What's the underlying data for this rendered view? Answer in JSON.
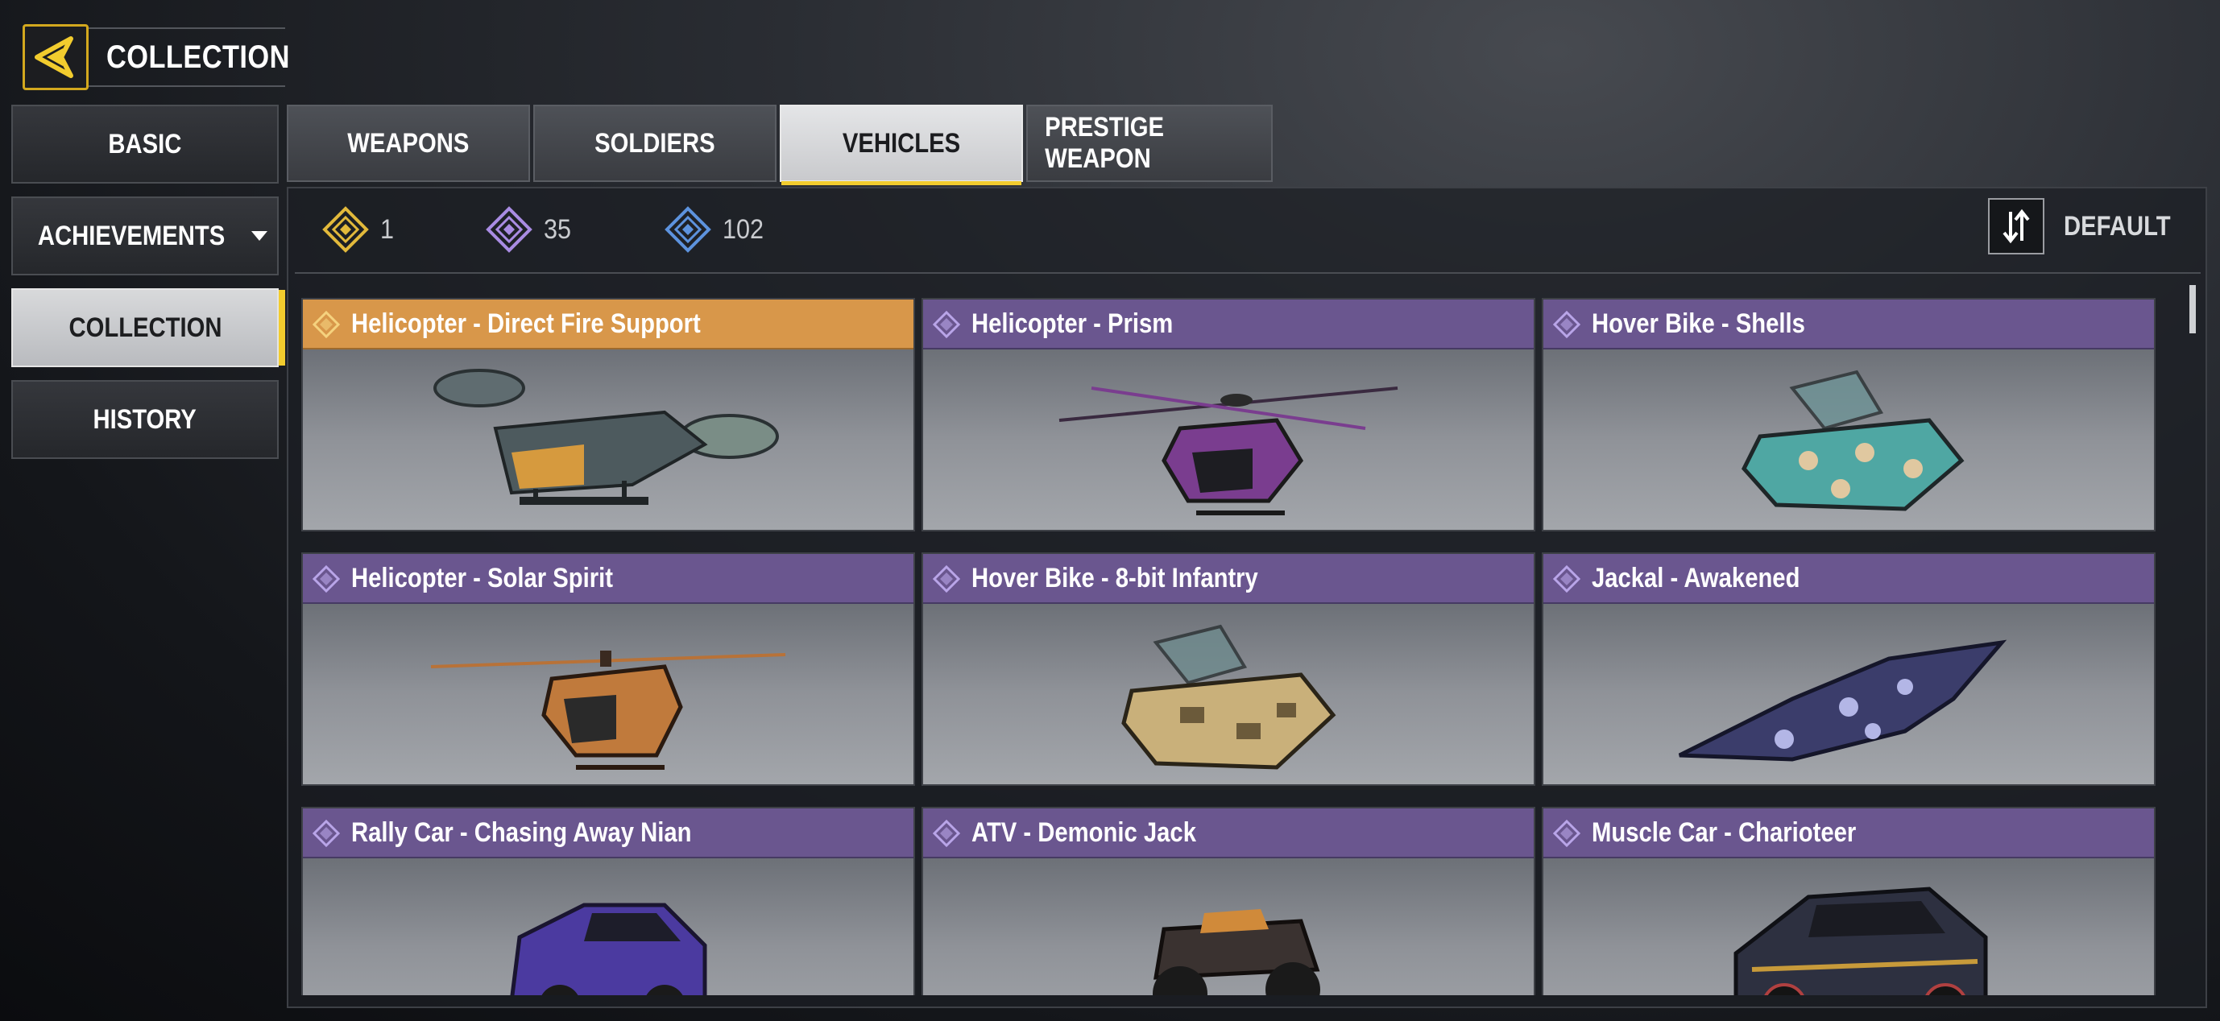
{
  "header": {
    "title": "COLLECTION"
  },
  "sidebar": {
    "items": [
      {
        "label": "BASIC"
      },
      {
        "label": "ACHIEVEMENTS"
      },
      {
        "label": "COLLECTION"
      },
      {
        "label": "HISTORY"
      }
    ],
    "active_index": 2
  },
  "tabs": [
    {
      "label": "WEAPONS"
    },
    {
      "label": "SOLDIERS"
    },
    {
      "label": "VEHICLES"
    },
    {
      "label": "PRESTIGE WEAPON"
    }
  ],
  "active_tab_index": 2,
  "counters": [
    {
      "rarity": "legendary",
      "value": "1",
      "color": "#e2b93b"
    },
    {
      "rarity": "epic",
      "value": "35",
      "color": "#a98ce3"
    },
    {
      "rarity": "rare",
      "value": "102",
      "color": "#5d93de"
    }
  ],
  "sort": {
    "label": "DEFAULT",
    "icon": "sort-arrows-icon"
  },
  "items": [
    {
      "name": "Helicopter - Direct Fire Support",
      "rarity": "legendary",
      "vehicle": "helicopter",
      "color": "#4d5a5e"
    },
    {
      "name": "Helicopter - Prism",
      "rarity": "epic",
      "vehicle": "helicopter",
      "color": "#7a3d8f"
    },
    {
      "name": "Hover Bike - Shells",
      "rarity": "epic",
      "vehicle": "hoverbike",
      "color": "#4fa7a3"
    },
    {
      "name": "Helicopter - Solar Spirit",
      "rarity": "epic",
      "vehicle": "helicopter",
      "color": "#c07a3c"
    },
    {
      "name": "Hover Bike - 8-bit Infantry",
      "rarity": "epic",
      "vehicle": "hoverbike",
      "color": "#c9b07a"
    },
    {
      "name": "Jackal - Awakened",
      "rarity": "epic",
      "vehicle": "jet",
      "color": "#3b3d6b"
    },
    {
      "name": "Rally Car - Chasing Away Nian",
      "rarity": "epic",
      "vehicle": "car",
      "color": "#4b3aa0"
    },
    {
      "name": "ATV - Demonic Jack",
      "rarity": "epic",
      "vehicle": "atv",
      "color": "#3a3230"
    },
    {
      "name": "Muscle Car - Charioteer",
      "rarity": "epic",
      "vehicle": "car",
      "color": "#2d3040"
    }
  ],
  "colors": {
    "accent": "#f2cc2e",
    "legendary_header": "#d8974a",
    "epic_header": "#6a568f"
  }
}
